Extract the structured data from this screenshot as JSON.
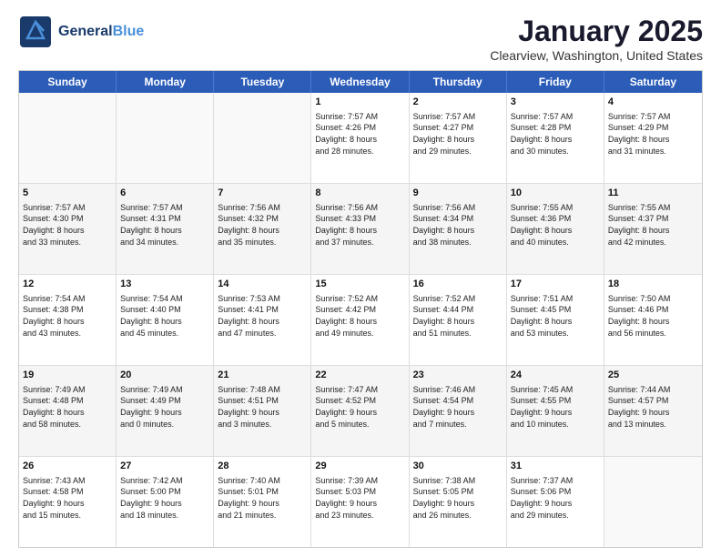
{
  "header": {
    "logo_general": "General",
    "logo_blue": "Blue",
    "title": "January 2025",
    "subtitle": "Clearview, Washington, United States"
  },
  "days": [
    "Sunday",
    "Monday",
    "Tuesday",
    "Wednesday",
    "Thursday",
    "Friday",
    "Saturday"
  ],
  "rows": [
    [
      {
        "day": "",
        "content": ""
      },
      {
        "day": "",
        "content": ""
      },
      {
        "day": "",
        "content": ""
      },
      {
        "day": "1",
        "content": "Sunrise: 7:57 AM\nSunset: 4:26 PM\nDaylight: 8 hours\nand 28 minutes."
      },
      {
        "day": "2",
        "content": "Sunrise: 7:57 AM\nSunset: 4:27 PM\nDaylight: 8 hours\nand 29 minutes."
      },
      {
        "day": "3",
        "content": "Sunrise: 7:57 AM\nSunset: 4:28 PM\nDaylight: 8 hours\nand 30 minutes."
      },
      {
        "day": "4",
        "content": "Sunrise: 7:57 AM\nSunset: 4:29 PM\nDaylight: 8 hours\nand 31 minutes."
      }
    ],
    [
      {
        "day": "5",
        "content": "Sunrise: 7:57 AM\nSunset: 4:30 PM\nDaylight: 8 hours\nand 33 minutes."
      },
      {
        "day": "6",
        "content": "Sunrise: 7:57 AM\nSunset: 4:31 PM\nDaylight: 8 hours\nand 34 minutes."
      },
      {
        "day": "7",
        "content": "Sunrise: 7:56 AM\nSunset: 4:32 PM\nDaylight: 8 hours\nand 35 minutes."
      },
      {
        "day": "8",
        "content": "Sunrise: 7:56 AM\nSunset: 4:33 PM\nDaylight: 8 hours\nand 37 minutes."
      },
      {
        "day": "9",
        "content": "Sunrise: 7:56 AM\nSunset: 4:34 PM\nDaylight: 8 hours\nand 38 minutes."
      },
      {
        "day": "10",
        "content": "Sunrise: 7:55 AM\nSunset: 4:36 PM\nDaylight: 8 hours\nand 40 minutes."
      },
      {
        "day": "11",
        "content": "Sunrise: 7:55 AM\nSunset: 4:37 PM\nDaylight: 8 hours\nand 42 minutes."
      }
    ],
    [
      {
        "day": "12",
        "content": "Sunrise: 7:54 AM\nSunset: 4:38 PM\nDaylight: 8 hours\nand 43 minutes."
      },
      {
        "day": "13",
        "content": "Sunrise: 7:54 AM\nSunset: 4:40 PM\nDaylight: 8 hours\nand 45 minutes."
      },
      {
        "day": "14",
        "content": "Sunrise: 7:53 AM\nSunset: 4:41 PM\nDaylight: 8 hours\nand 47 minutes."
      },
      {
        "day": "15",
        "content": "Sunrise: 7:52 AM\nSunset: 4:42 PM\nDaylight: 8 hours\nand 49 minutes."
      },
      {
        "day": "16",
        "content": "Sunrise: 7:52 AM\nSunset: 4:44 PM\nDaylight: 8 hours\nand 51 minutes."
      },
      {
        "day": "17",
        "content": "Sunrise: 7:51 AM\nSunset: 4:45 PM\nDaylight: 8 hours\nand 53 minutes."
      },
      {
        "day": "18",
        "content": "Sunrise: 7:50 AM\nSunset: 4:46 PM\nDaylight: 8 hours\nand 56 minutes."
      }
    ],
    [
      {
        "day": "19",
        "content": "Sunrise: 7:49 AM\nSunset: 4:48 PM\nDaylight: 8 hours\nand 58 minutes."
      },
      {
        "day": "20",
        "content": "Sunrise: 7:49 AM\nSunset: 4:49 PM\nDaylight: 9 hours\nand 0 minutes."
      },
      {
        "day": "21",
        "content": "Sunrise: 7:48 AM\nSunset: 4:51 PM\nDaylight: 9 hours\nand 3 minutes."
      },
      {
        "day": "22",
        "content": "Sunrise: 7:47 AM\nSunset: 4:52 PM\nDaylight: 9 hours\nand 5 minutes."
      },
      {
        "day": "23",
        "content": "Sunrise: 7:46 AM\nSunset: 4:54 PM\nDaylight: 9 hours\nand 7 minutes."
      },
      {
        "day": "24",
        "content": "Sunrise: 7:45 AM\nSunset: 4:55 PM\nDaylight: 9 hours\nand 10 minutes."
      },
      {
        "day": "25",
        "content": "Sunrise: 7:44 AM\nSunset: 4:57 PM\nDaylight: 9 hours\nand 13 minutes."
      }
    ],
    [
      {
        "day": "26",
        "content": "Sunrise: 7:43 AM\nSunset: 4:58 PM\nDaylight: 9 hours\nand 15 minutes."
      },
      {
        "day": "27",
        "content": "Sunrise: 7:42 AM\nSunset: 5:00 PM\nDaylight: 9 hours\nand 18 minutes."
      },
      {
        "day": "28",
        "content": "Sunrise: 7:40 AM\nSunset: 5:01 PM\nDaylight: 9 hours\nand 21 minutes."
      },
      {
        "day": "29",
        "content": "Sunrise: 7:39 AM\nSunset: 5:03 PM\nDaylight: 9 hours\nand 23 minutes."
      },
      {
        "day": "30",
        "content": "Sunrise: 7:38 AM\nSunset: 5:05 PM\nDaylight: 9 hours\nand 26 minutes."
      },
      {
        "day": "31",
        "content": "Sunrise: 7:37 AM\nSunset: 5:06 PM\nDaylight: 9 hours\nand 29 minutes."
      },
      {
        "day": "",
        "content": ""
      }
    ]
  ]
}
